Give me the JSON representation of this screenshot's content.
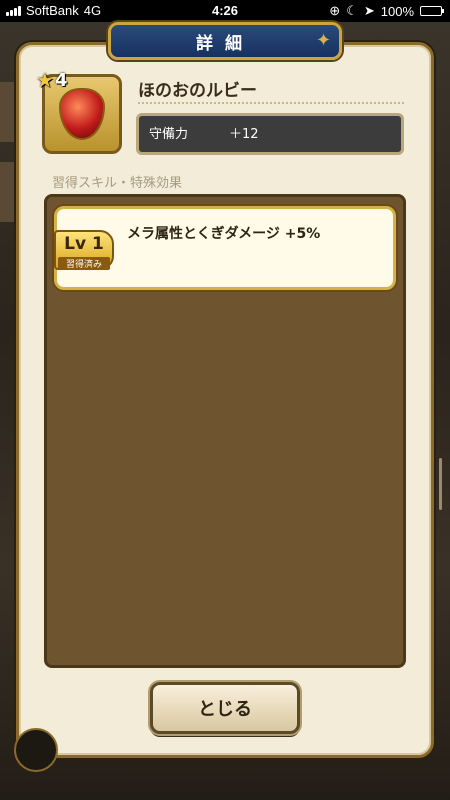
{
  "status_bar": {
    "carrier": "SoftBank",
    "network": "4G",
    "time": "4:26",
    "battery": "100%"
  },
  "modal": {
    "title": "詳細",
    "item": {
      "rarity": "4",
      "name": "ほのおのルビー",
      "stat_label": "守備力",
      "stat_value": "＋12"
    },
    "section_label": "習得スキル・特殊効果",
    "skills": [
      {
        "level": "Lv 1",
        "status": "習得済み",
        "text": "メラ属性とくぎダメージ +5%"
      }
    ],
    "close_label": "とじる"
  }
}
